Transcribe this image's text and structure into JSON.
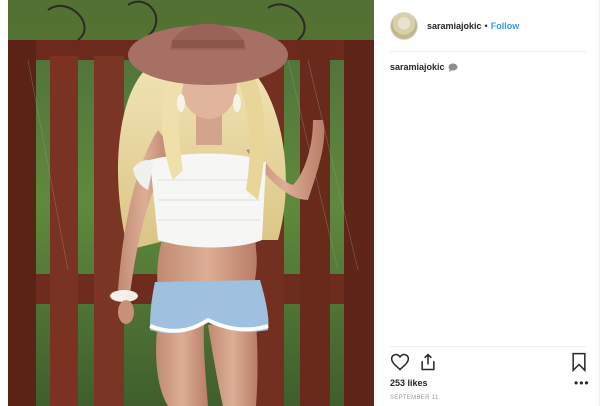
{
  "post": {
    "username": "saramiajokic",
    "follow_label": "Follow",
    "separator": "•",
    "caption_user": "saramiajokic",
    "likes": "253 likes",
    "date": "SEPTEMBER 11",
    "more_label": "•••"
  },
  "icons": {
    "like": "heart-icon",
    "share": "share-icon",
    "save": "bookmark-icon",
    "caption": "speech-bubble-icon"
  },
  "colors": {
    "follow_blue": "#3897f0",
    "text": "#262626",
    "muted": "#999999"
  }
}
